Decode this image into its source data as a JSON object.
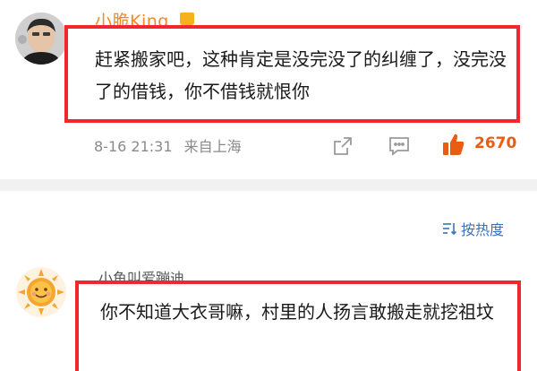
{
  "comment1": {
    "username": "小脆King",
    "text": "赶紧搬家吧，这种肯定是没完没了的纠缠了，没完没了的借钱，你不借钱就恨你",
    "timestamp": "8-16 21:31",
    "location": "来自上海",
    "like_count": "2670"
  },
  "sort": {
    "label": "按热度"
  },
  "comment2": {
    "username": "小鱼叫爱蹦迪",
    "text": "你不知道大衣哥嘛，村里的人扬言敢搬走就挖祖坟"
  },
  "colors": {
    "highlight_border": "#f0272d",
    "like_accent": "#ea5c0f",
    "link_blue": "#3a73b6",
    "username_orange": "#f08a2a"
  }
}
